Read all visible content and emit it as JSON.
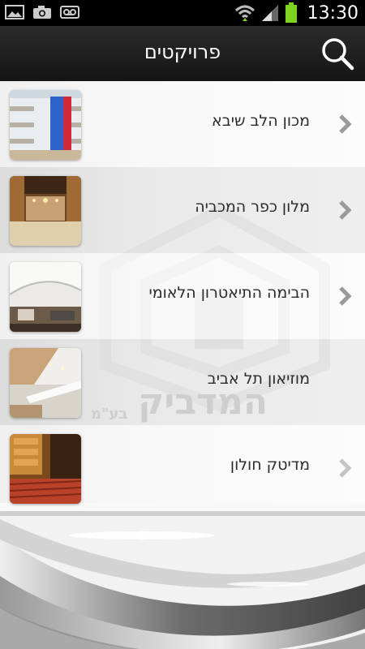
{
  "status_bar": {
    "time": "13:30",
    "icons": [
      "gallery-icon",
      "camera-icon",
      "voicemail-icon",
      "wifi-icon",
      "signal-icon",
      "battery-icon"
    ]
  },
  "action_bar": {
    "title": "פרויקטים",
    "search_icon": "search-icon"
  },
  "projects": [
    {
      "label": "מכון הלב שיבא",
      "thumb": "atrium-photo",
      "chevron": true
    },
    {
      "label": "מלון כפר המכביה",
      "thumb": "hotel-lobby-photo",
      "chevron": true
    },
    {
      "label": "הבימה התיאטרון הלאומי",
      "thumb": "theatre-lobby-photo",
      "chevron": true
    },
    {
      "label": "מוזיאון תל אביב",
      "thumb": "museum-interior-photo",
      "chevron": false
    },
    {
      "label": "מדיטק חולון",
      "thumb": "auditorium-photo",
      "chevron": true
    }
  ],
  "watermark": {
    "text": "המדביק",
    "suffix": "בע\"מ"
  },
  "colors": {
    "status_bar": "#000000",
    "action_bar": "#1e1e1e",
    "battery": "#7ed321",
    "label": "#2b2b2b"
  }
}
